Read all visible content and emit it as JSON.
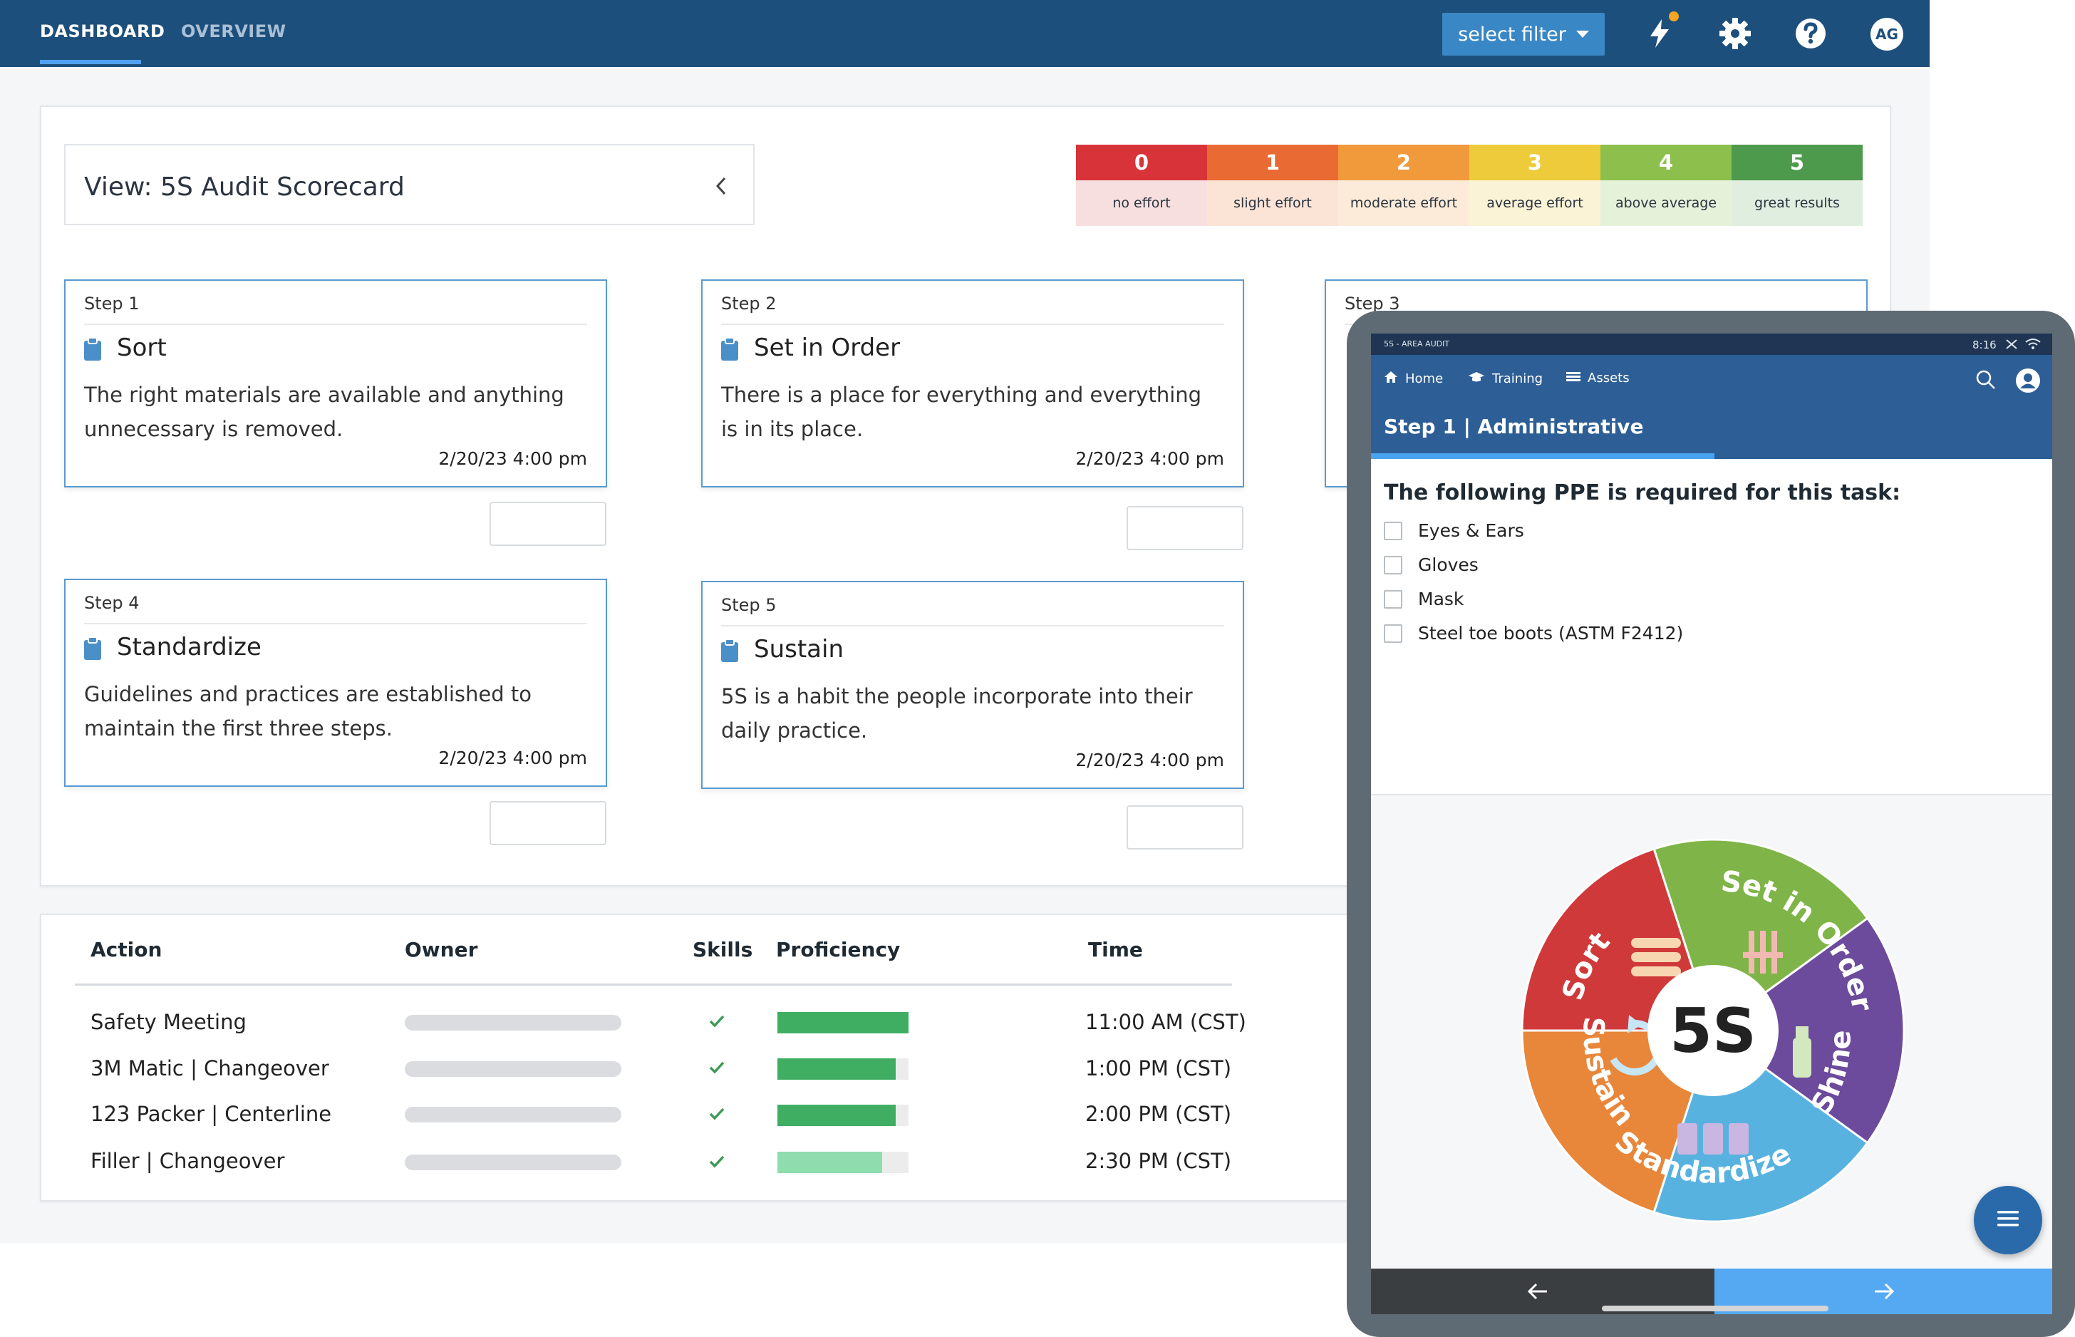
{
  "nav": {
    "tabs": [
      "DASHBOARD",
      "OVERVIEW"
    ],
    "filter_label": "select filter",
    "avatar_initials": "AG"
  },
  "view": {
    "title": "View: 5S Audit Scorecard"
  },
  "scale": [
    {
      "num": "0",
      "label": "no effort",
      "color": "#d9333a",
      "light": "#f7dfe0"
    },
    {
      "num": "1",
      "label": "slight effort",
      "color": "#ea6a33",
      "light": "#fbe4d6"
    },
    {
      "num": "2",
      "label": "moderate effort",
      "color": "#f09a3c",
      "light": "#fcebd8"
    },
    {
      "num": "3",
      "label": "average effort",
      "color": "#eecb3b",
      "light": "#fbf3d6"
    },
    {
      "num": "4",
      "label": "above average",
      "color": "#8cbf4c",
      "light": "#e6f1da"
    },
    {
      "num": "5",
      "label": "great results",
      "color": "#4d9a4d",
      "light": "#dfeedf"
    }
  ],
  "cards": [
    {
      "step": "Step 1",
      "title": "Sort",
      "desc": "The right materials are available and anything unnecessary is removed.",
      "date": "2/20/23 4:00 pm"
    },
    {
      "step": "Step 2",
      "title": "Set in Order",
      "desc": "There is a place for everything and everything is in its place.",
      "date": "2/20/23 4:00 pm"
    },
    {
      "step": "Step 3"
    },
    {
      "step": "Step 4",
      "title": "Standardize",
      "desc": "Guidelines and practices are established to maintain the first three steps.",
      "date": "2/20/23 4:00 pm"
    },
    {
      "step": "Step 5",
      "title": "Sustain",
      "desc": "5S is a habit the people incorporate into their daily practice.",
      "date": "2/20/23 4:00 pm"
    }
  ],
  "table": {
    "headers": [
      "Action",
      "Owner",
      "Skills",
      "Proficiency",
      "Time"
    ],
    "rows": [
      {
        "action": "Safety Meeting",
        "proficiency": 1.0,
        "time": "11:00 AM (CST)"
      },
      {
        "action": "3M Matic | Changeover",
        "proficiency": 0.9,
        "time": "1:00 PM (CST)"
      },
      {
        "action": "123 Packer | Centerline",
        "proficiency": 0.9,
        "time": "2:00 PM (CST)"
      },
      {
        "action": "Filler | Changeover",
        "proficiency": 0.8,
        "time": "2:30 PM (CST)"
      }
    ]
  },
  "tablet": {
    "status_title": "5S - AREA AUDIT",
    "status_time": "8:16",
    "nav": [
      "Home",
      "Training",
      "Assets"
    ],
    "step_title": "Step 1 | Administrative",
    "heading": "The following PPE is required for this task:",
    "ppe_items": [
      "Eyes & Ears",
      "Gloves",
      "Mask",
      "Steel toe boots (ASTM F2412)"
    ],
    "wheel": {
      "center": "5S",
      "segments": [
        {
          "label": "Sort",
          "color": "#e8863a"
        },
        {
          "label": "Set in Order",
          "color": "#d0393a"
        },
        {
          "label": "Shine",
          "color": "#7fb548"
        },
        {
          "label": "Standardize",
          "color": "#6c4a9c"
        },
        {
          "label": "Sustain",
          "color": "#58b2e0"
        }
      ]
    }
  }
}
